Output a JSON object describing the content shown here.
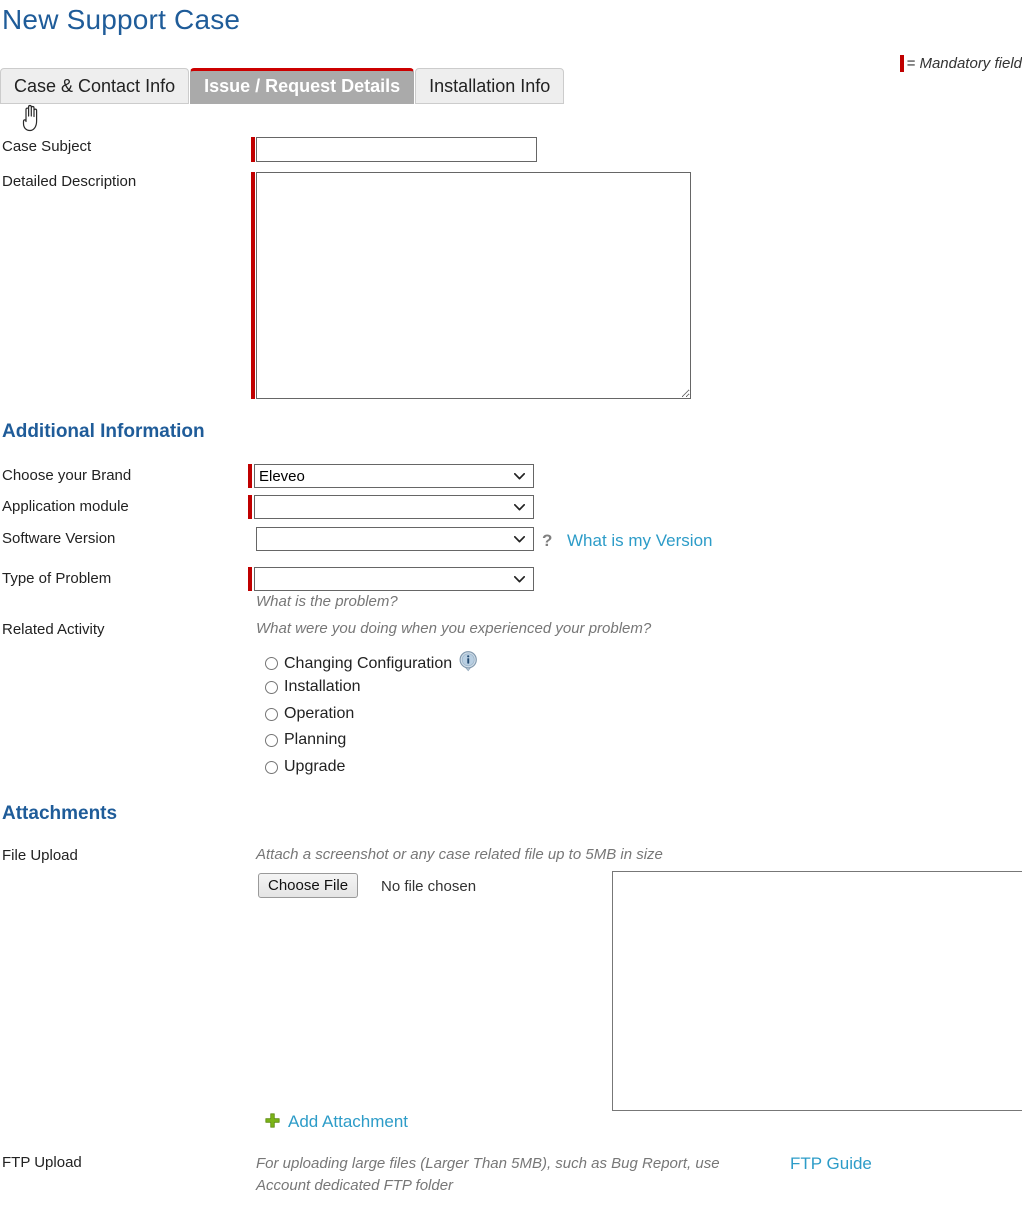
{
  "page": {
    "title": "New Support Case"
  },
  "legend": {
    "icon": "mandatory-bar",
    "text": "= Mandatory field",
    "color": "#c00000"
  },
  "tabs": [
    {
      "label": "Case & Contact Info",
      "active": false
    },
    {
      "label": "Issue / Request Details",
      "active": true
    },
    {
      "label": "Installation Info",
      "active": false
    }
  ],
  "cursor": {
    "icon": "pointing-hand-cursor"
  },
  "fields": {
    "case_subject": {
      "label": "Case Subject",
      "value": "",
      "placeholder": "",
      "mandatory": true
    },
    "detailed_description": {
      "label": "Detailed Description",
      "value": "",
      "placeholder": "",
      "mandatory": true
    }
  },
  "additional_information": {
    "heading": "Additional Information",
    "brand": {
      "label": "Choose your Brand",
      "value": "Eleveo",
      "options": [
        "Eleveo"
      ],
      "mandatory": true
    },
    "application_module": {
      "label": "Application module",
      "value": "",
      "options": [
        ""
      ],
      "mandatory": true
    },
    "software_version": {
      "label": "Software Version",
      "value": "",
      "options": [
        ""
      ],
      "mandatory": false,
      "help_icon": "question-mark-icon",
      "help_link": "What is my Version"
    },
    "type_of_problem": {
      "label": "Type of Problem",
      "value": "",
      "options": [
        ""
      ],
      "mandatory": true,
      "helper": "What is the problem?"
    },
    "related_activity": {
      "label": "Related Activity",
      "helper": "What were you doing when you experienced your problem?",
      "options": [
        {
          "label": "Changing Configuration",
          "checked": false,
          "info_icon": "info-icon"
        },
        {
          "label": "Installation",
          "checked": false
        },
        {
          "label": "Operation",
          "checked": false
        },
        {
          "label": "Planning",
          "checked": false
        },
        {
          "label": "Upgrade",
          "checked": false
        }
      ]
    }
  },
  "attachments": {
    "heading": "Attachments",
    "file_upload": {
      "label": "File Upload",
      "helper": "Attach a screenshot or any case related file up to 5MB in size",
      "button_label": "Choose File",
      "file_name": "No file chosen",
      "list_items": []
    },
    "add_attachment": {
      "icon": "plus-icon",
      "label": "Add Attachment",
      "icon_color": "#7ab317"
    },
    "ftp_upload": {
      "label": "FTP Upload",
      "description": "For uploading large files (Larger Than 5MB), such as Bug Report, use Account dedicated FTP folder",
      "guide_link": "FTP Guide"
    }
  },
  "colors": {
    "heading_blue": "#1f5c99",
    "link_teal": "#2d9cc8",
    "mandatory_red": "#c00000",
    "active_tab_bg": "#aaaaaa",
    "active_tab_border": "#cc0000"
  }
}
